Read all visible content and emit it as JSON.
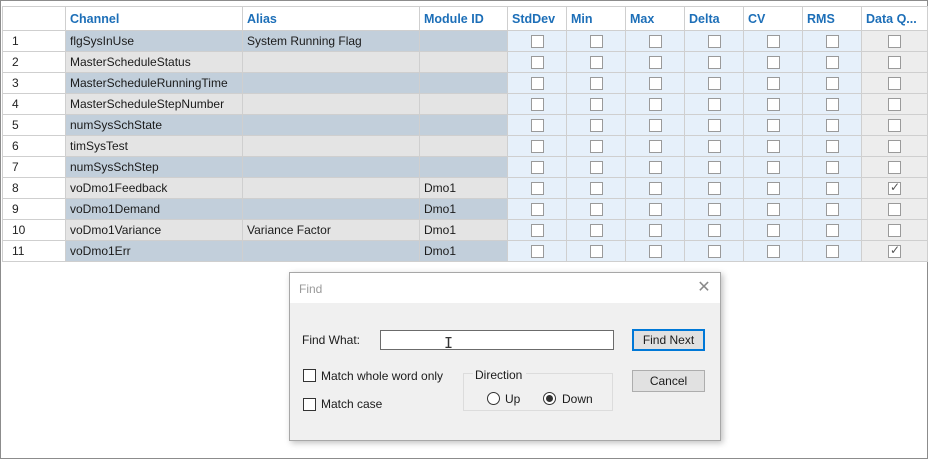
{
  "grid": {
    "columns": [
      "",
      "Channel",
      "Alias",
      "Module ID",
      "StdDev",
      "Min",
      "Max",
      "Delta",
      "CV",
      "RMS",
      "Data Q..."
    ],
    "rows": [
      {
        "num": "1",
        "channel": "flgSysInUse",
        "alias": "System Running Flag",
        "module": "",
        "dq": false
      },
      {
        "num": "2",
        "channel": "MasterScheduleStatus",
        "alias": "",
        "module": "",
        "dq": false
      },
      {
        "num": "3",
        "channel": "MasterScheduleRunningTime",
        "alias": "",
        "module": "",
        "dq": false
      },
      {
        "num": "4",
        "channel": "MasterScheduleStepNumber",
        "alias": "",
        "module": "",
        "dq": false
      },
      {
        "num": "5",
        "channel": "numSysSchState",
        "alias": "",
        "module": "",
        "dq": false
      },
      {
        "num": "6",
        "channel": "timSysTest",
        "alias": "",
        "module": "",
        "dq": false
      },
      {
        "num": "7",
        "channel": "numSysSchStep",
        "alias": "",
        "module": "",
        "dq": false
      },
      {
        "num": "8",
        "channel": "voDmo1Feedback",
        "alias": "",
        "module": "Dmo1",
        "dq": true
      },
      {
        "num": "9",
        "channel": "voDmo1Demand",
        "alias": "",
        "module": "Dmo1",
        "dq": false
      },
      {
        "num": "10",
        "channel": "voDmo1Variance",
        "alias": "Variance Factor",
        "module": "Dmo1",
        "dq": false
      },
      {
        "num": "11",
        "channel": "voDmo1Err",
        "alias": "",
        "module": "Dmo1",
        "dq": true
      }
    ]
  },
  "find_dialog": {
    "title": "Find",
    "find_what_label": "Find What:",
    "find_what_value": "",
    "find_next_label": "Find Next",
    "cancel_label": "Cancel",
    "match_whole_word_label": "Match whole word only",
    "match_case_label": "Match case",
    "direction_label": "Direction",
    "up_label": "Up",
    "down_label": "Down",
    "direction_selected": "Down",
    "close_icon": "close-icon"
  },
  "colors": {
    "header_text": "#1d6fb8",
    "row_text_bg_a": "#c2cfdb",
    "row_text_bg_b": "#e4e4e4",
    "checkbox_cell_bg": "#e6f0fa"
  }
}
